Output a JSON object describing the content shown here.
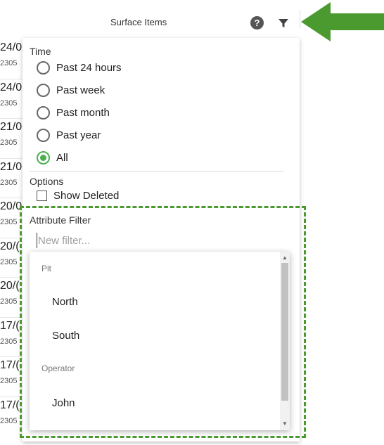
{
  "header": {
    "title": "Surface Items",
    "help_icon": "help-circle-icon",
    "filter_icon": "filter-icon"
  },
  "background_list": [
    {
      "date": "24/0",
      "id": "2305"
    },
    {
      "date": "24/0",
      "id": "2305"
    },
    {
      "date": "21/0",
      "id": "2305"
    },
    {
      "date": "21/0",
      "id": "2305"
    },
    {
      "date": "20/0",
      "id": "2305"
    },
    {
      "date": "20/(",
      "id": "2305"
    },
    {
      "date": "20/(",
      "id": "2305"
    },
    {
      "date": "17/(",
      "id": "2305"
    },
    {
      "date": "17/(",
      "id": "2305"
    },
    {
      "date": "17/(",
      "id": "2305"
    }
  ],
  "filter_panel": {
    "time_label": "Time",
    "time_options": [
      {
        "label": "Past 24 hours",
        "checked": false
      },
      {
        "label": "Past week",
        "checked": false
      },
      {
        "label": "Past month",
        "checked": false
      },
      {
        "label": "Past year",
        "checked": false
      },
      {
        "label": "All",
        "checked": true
      }
    ],
    "options_label": "Options",
    "show_deleted_label": "Show Deleted",
    "show_deleted_checked": false,
    "attribute_filter_label": "Attribute Filter",
    "attribute_filter_placeholder": "New filter..."
  },
  "dropdown": {
    "groups": [
      {
        "header": "Pit",
        "options": [
          "North",
          "South"
        ]
      },
      {
        "header": "Operator",
        "options": [
          "John"
        ]
      }
    ]
  },
  "colors": {
    "accent": "#4caf50",
    "highlight": "#4a9a30",
    "arrow": "#4a9a30"
  }
}
